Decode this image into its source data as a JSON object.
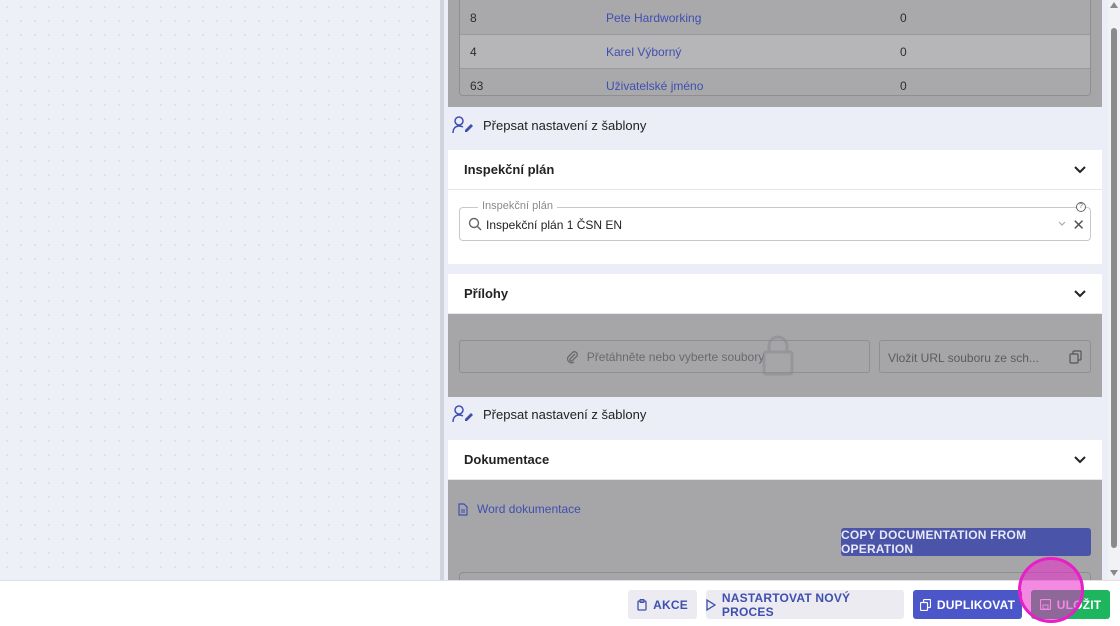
{
  "users_table": {
    "rows": [
      {
        "id": "8",
        "name": "Pete Hardworking",
        "value": "0"
      },
      {
        "id": "4",
        "name": "Karel Výborný",
        "value": "0"
      },
      {
        "id": "63",
        "name": "Uživatelské jméno",
        "value": "0"
      }
    ]
  },
  "override_label": "Přepsat nastavení z šablony",
  "inspection": {
    "title": "Inspekční plán",
    "field_label": "Inspekční plán",
    "field_value": "Inspekční plán 1 ČSN EN"
  },
  "attachments": {
    "title": "Přílohy",
    "drop_label": "Přetáhněte nebo vyberte soubory",
    "url_placeholder": "Vložit URL souboru ze sch..."
  },
  "documentation": {
    "title": "Dokumentace",
    "word_link": "Word dokumentace",
    "copy_button": "COPY DOCUMENTATION FROM OPERATION"
  },
  "actions": {
    "akce": "AKCE",
    "start_process": "NASTARTOVAT NOVÝ PROCES",
    "duplicate": "DUPLIKOVAT",
    "save": "ULOŽIT"
  },
  "colors": {
    "accent": "#4b56c8",
    "save": "#1db65e",
    "highlight": "#e81ec8"
  }
}
